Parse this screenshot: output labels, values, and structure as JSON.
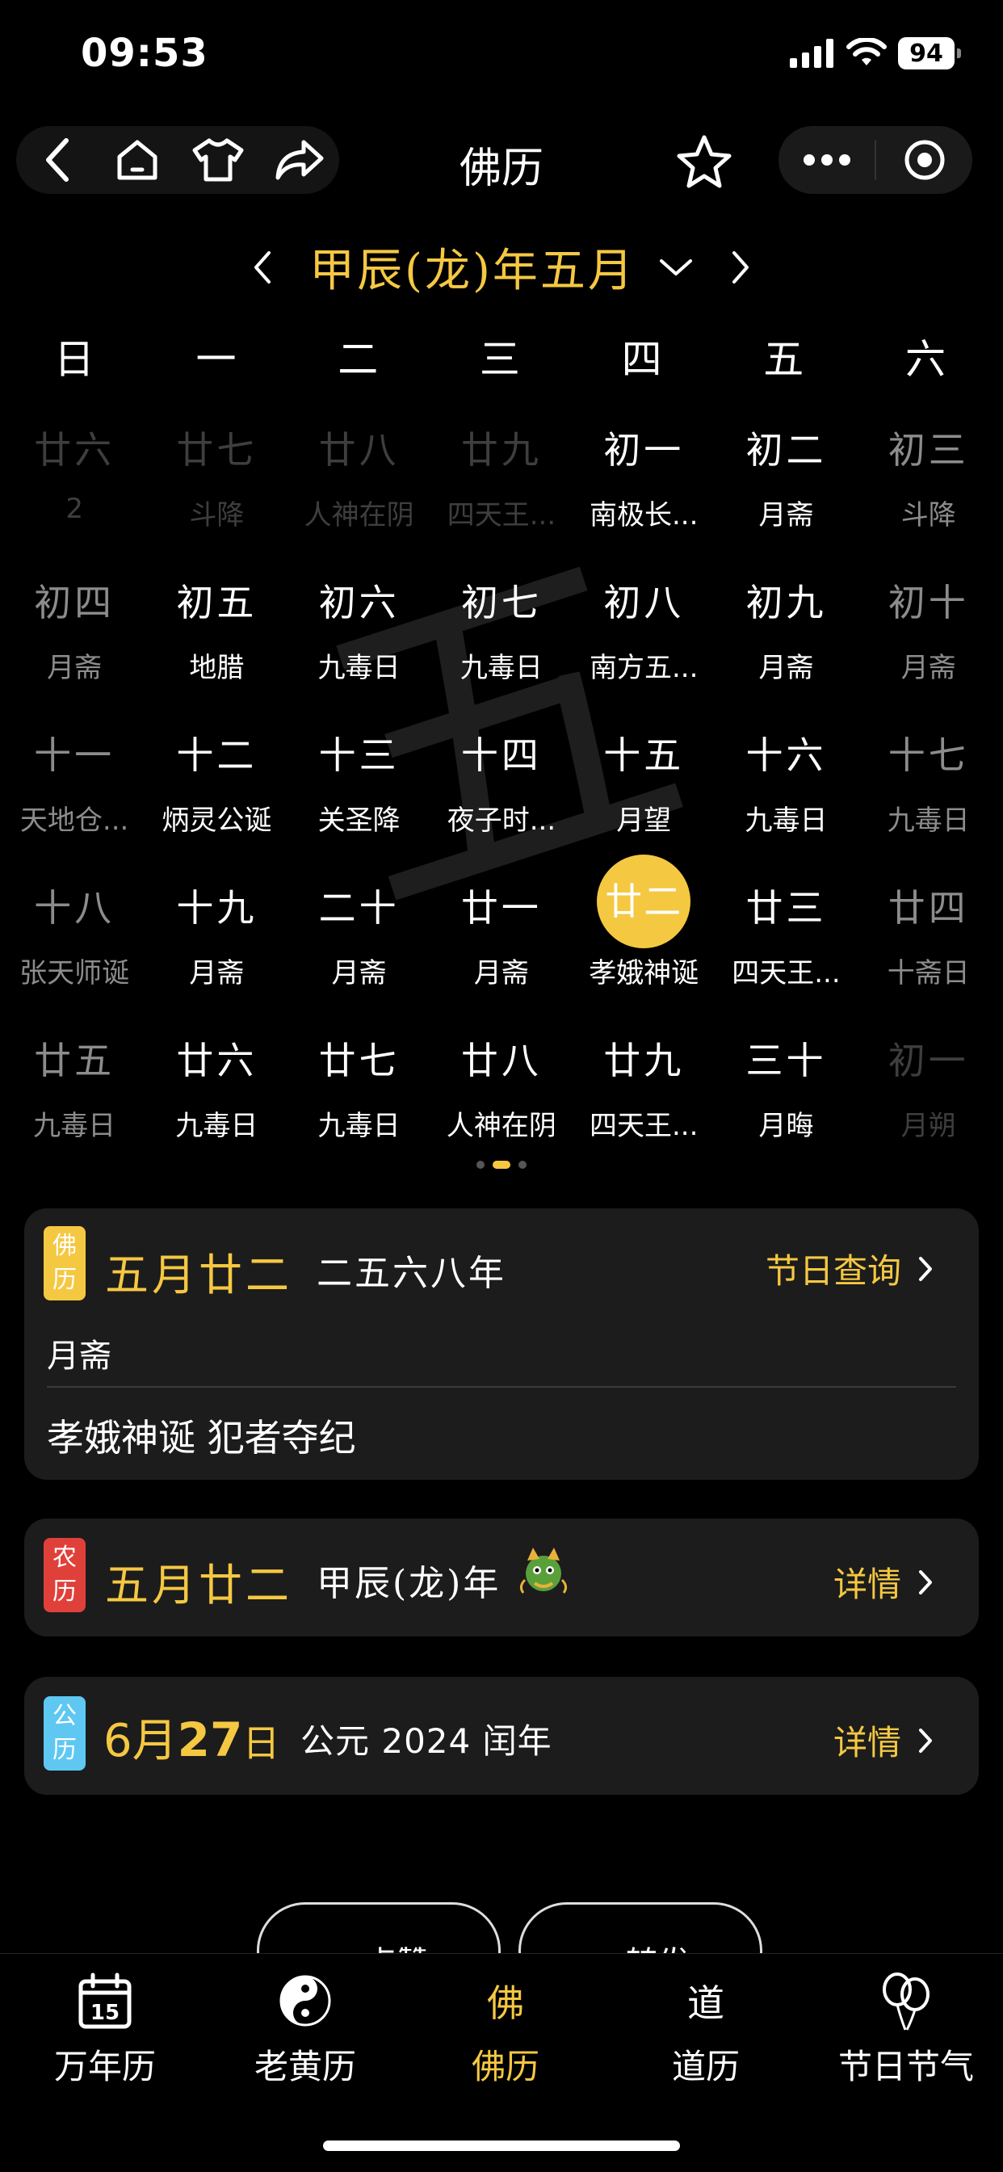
{
  "status_bar": {
    "time": "09:53",
    "battery": "94"
  },
  "nav": {
    "title": "佛历"
  },
  "month_selector": {
    "label": "甲辰(龙)年五月"
  },
  "weekdays": [
    "日",
    "一",
    "二",
    "三",
    "四",
    "五",
    "六"
  ],
  "calendar": [
    {
      "lunar": "廿六",
      "fest": "2",
      "state": "faint"
    },
    {
      "lunar": "廿七",
      "fest": "斗降",
      "state": "faint"
    },
    {
      "lunar": "廿八",
      "fest": "人神在阴",
      "state": "faint"
    },
    {
      "lunar": "廿九",
      "fest": "四天王...",
      "state": "faint"
    },
    {
      "lunar": "初一",
      "fest": "南极长...",
      "state": "normal"
    },
    {
      "lunar": "初二",
      "fest": "月斋",
      "state": "normal"
    },
    {
      "lunar": "初三",
      "fest": "斗降",
      "state": "dim"
    },
    {
      "lunar": "初四",
      "fest": "月斋",
      "state": "dim"
    },
    {
      "lunar": "初五",
      "fest": "地腊",
      "state": "normal"
    },
    {
      "lunar": "初六",
      "fest": "九毒日",
      "state": "normal"
    },
    {
      "lunar": "初七",
      "fest": "九毒日",
      "state": "normal"
    },
    {
      "lunar": "初八",
      "fest": "南方五...",
      "state": "normal"
    },
    {
      "lunar": "初九",
      "fest": "月斋",
      "state": "normal"
    },
    {
      "lunar": "初十",
      "fest": "月斋",
      "state": "dim"
    },
    {
      "lunar": "十一",
      "fest": "天地仓...",
      "state": "dim"
    },
    {
      "lunar": "十二",
      "fest": "炳灵公诞",
      "state": "normal"
    },
    {
      "lunar": "十三",
      "fest": "关圣降",
      "state": "normal"
    },
    {
      "lunar": "十四",
      "fest": "夜子时...",
      "state": "normal"
    },
    {
      "lunar": "十五",
      "fest": "月望",
      "state": "normal"
    },
    {
      "lunar": "十六",
      "fest": "九毒日",
      "state": "normal"
    },
    {
      "lunar": "十七",
      "fest": "九毒日",
      "state": "dim"
    },
    {
      "lunar": "十八",
      "fest": "张天师诞",
      "state": "dim"
    },
    {
      "lunar": "十九",
      "fest": "月斋",
      "state": "normal"
    },
    {
      "lunar": "二十",
      "fest": "月斋",
      "state": "normal"
    },
    {
      "lunar": "廿一",
      "fest": "月斋",
      "state": "normal"
    },
    {
      "lunar": "廿二",
      "fest": "孝娥神诞",
      "state": "today"
    },
    {
      "lunar": "廿三",
      "fest": "四天王...",
      "state": "normal"
    },
    {
      "lunar": "廿四",
      "fest": "十斋日",
      "state": "dim"
    },
    {
      "lunar": "廿五",
      "fest": "九毒日",
      "state": "dim"
    },
    {
      "lunar": "廿六",
      "fest": "九毒日",
      "state": "normal"
    },
    {
      "lunar": "廿七",
      "fest": "九毒日",
      "state": "normal"
    },
    {
      "lunar": "廿八",
      "fest": "人神在阴",
      "state": "normal"
    },
    {
      "lunar": "廿九",
      "fest": "四天王...",
      "state": "normal"
    },
    {
      "lunar": "三十",
      "fest": "月晦",
      "state": "normal"
    },
    {
      "lunar": "初一",
      "fest": "月朔",
      "state": "faint"
    }
  ],
  "watermark": "五",
  "buddhist_card": {
    "badge": [
      "佛",
      "历"
    ],
    "date": "五月廿二",
    "year": "二五六八年",
    "link": "节日查询",
    "line1": "月斋",
    "line2": "孝娥神诞 犯者夺纪"
  },
  "lunar_card": {
    "badge": [
      "农",
      "历"
    ],
    "date": "五月廿二",
    "year": "甲辰(龙)年",
    "link": "详情"
  },
  "gregorian_card": {
    "badge": [
      "公",
      "历"
    ],
    "month": "6月",
    "day": "27",
    "day_suffix": "日",
    "year": "公元 2024 闰年",
    "link": "详情"
  },
  "peek_buttons": [
    "点赞",
    "转发"
  ],
  "tabs": [
    {
      "label": "万年历",
      "icon": "calendar-icon"
    },
    {
      "label": "老黄历",
      "icon": "yin-yang-icon"
    },
    {
      "label": "佛历",
      "icon": "buddha-char-icon"
    },
    {
      "label": "道历",
      "icon": "dao-char-icon"
    },
    {
      "label": "节日节气",
      "icon": "balloons-icon"
    }
  ],
  "tab_calendar_day": "15",
  "colors": {
    "accent": "#f5c842",
    "buddhist_badge": "#f5c842",
    "lunar_badge": "#e0403a",
    "gregorian_badge": "#5ec8f2"
  }
}
